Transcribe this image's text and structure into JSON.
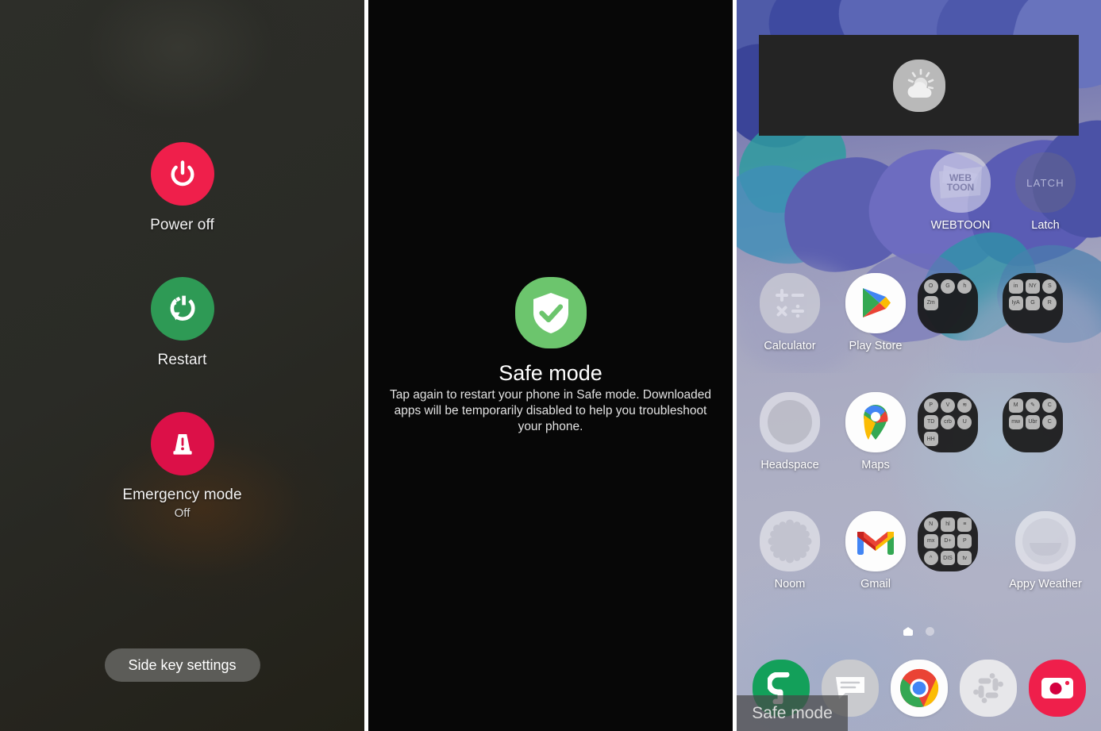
{
  "panel_power": {
    "name": "power-menu",
    "items": [
      {
        "label": "Power off",
        "sub": "",
        "icon": "power-icon",
        "color": "#ef1f4b"
      },
      {
        "label": "Restart",
        "sub": "",
        "icon": "restart-icon",
        "color": "#2e9a55"
      },
      {
        "label": "Emergency mode",
        "sub": "Off",
        "icon": "emergency-beacon-icon",
        "color": "#dc1048"
      }
    ],
    "side_key_button": "Side key settings"
  },
  "panel_safemode": {
    "icon": "shield-check-icon",
    "icon_color": "#6cc56d",
    "title": "Safe mode",
    "description": "Tap again to restart your phone in Safe mode. Downloaded apps will be temporarily disabled to help you troubleshoot your phone."
  },
  "panel_home": {
    "weather_widget": {
      "icon": "partly-cloudy-icon",
      "background": "#242424"
    },
    "rows": [
      {
        "cells": [
          {
            "type": "empty"
          },
          {
            "type": "empty"
          },
          {
            "type": "app",
            "label": "WEBTOON",
            "icon": "webtoon-icon",
            "icon_text": "WEB TOON",
            "disabled": true
          },
          {
            "type": "app",
            "label": "Latch",
            "icon": "latch-icon",
            "icon_text": "LATCH",
            "disabled": true
          }
        ]
      },
      {
        "cells": [
          {
            "type": "app",
            "label": "Calculator",
            "icon": "calculator-icon",
            "disabled": true
          },
          {
            "type": "app",
            "label": "Play Store",
            "icon": "play-store-icon",
            "disabled": false
          },
          {
            "type": "folder",
            "label": "",
            "icon": "folder-icon",
            "minis": [
              "O",
              "G",
              "h",
              "Zoom"
            ]
          },
          {
            "type": "folder",
            "label": "",
            "icon": "folder-icon",
            "minis": [
              "inst",
              "NY",
              "S",
              "IyA",
              "G",
              "R"
            ]
          }
        ]
      },
      {
        "cells": [
          {
            "type": "app",
            "label": "Headspace",
            "icon": "headspace-icon",
            "disabled": true
          },
          {
            "type": "app",
            "label": "Maps",
            "icon": "maps-icon",
            "disabled": false
          },
          {
            "type": "folder",
            "label": "",
            "icon": "folder-icon",
            "minis": [
              "P",
              "V",
              "≋",
              "TD",
              "crb",
              "U",
              "HH"
            ]
          },
          {
            "type": "folder",
            "label": "",
            "icon": "folder-icon",
            "minis": [
              "M",
              "✎",
              "C",
              "mw",
              "Uber",
              "C"
            ]
          }
        ]
      },
      {
        "cells": [
          {
            "type": "app",
            "label": "Noom",
            "icon": "noom-icon",
            "disabled": true
          },
          {
            "type": "app",
            "label": "Gmail",
            "icon": "gmail-icon",
            "disabled": false
          },
          {
            "type": "folder",
            "label": "",
            "icon": "folder-icon",
            "minis": [
              "N",
              "hulu",
              "≡",
              "max",
              "D+",
              "P",
              "^",
              "DIS",
              "tv"
            ]
          },
          {
            "type": "app",
            "label": "Appy Weather",
            "icon": "appy-weather-icon",
            "disabled": true
          }
        ]
      }
    ],
    "page_indicator": {
      "pages": 2,
      "current": 0,
      "home_page_icon": "home-icon"
    },
    "dock": [
      {
        "label": "Phone",
        "icon": "phone-icon",
        "color": "#13a05a",
        "disabled": false
      },
      {
        "label": "Messages",
        "icon": "messages-icon",
        "color": "#c9cace",
        "disabled": true
      },
      {
        "label": "Chrome",
        "icon": "chrome-icon",
        "color": "#ffffff",
        "disabled": false
      },
      {
        "label": "Slack",
        "icon": "slack-icon",
        "color": "#e7e7ea",
        "disabled": true
      },
      {
        "label": "Camera",
        "icon": "camera-icon",
        "color": "#ef1f4b",
        "disabled": false
      }
    ],
    "status_badge": "Safe mode"
  }
}
